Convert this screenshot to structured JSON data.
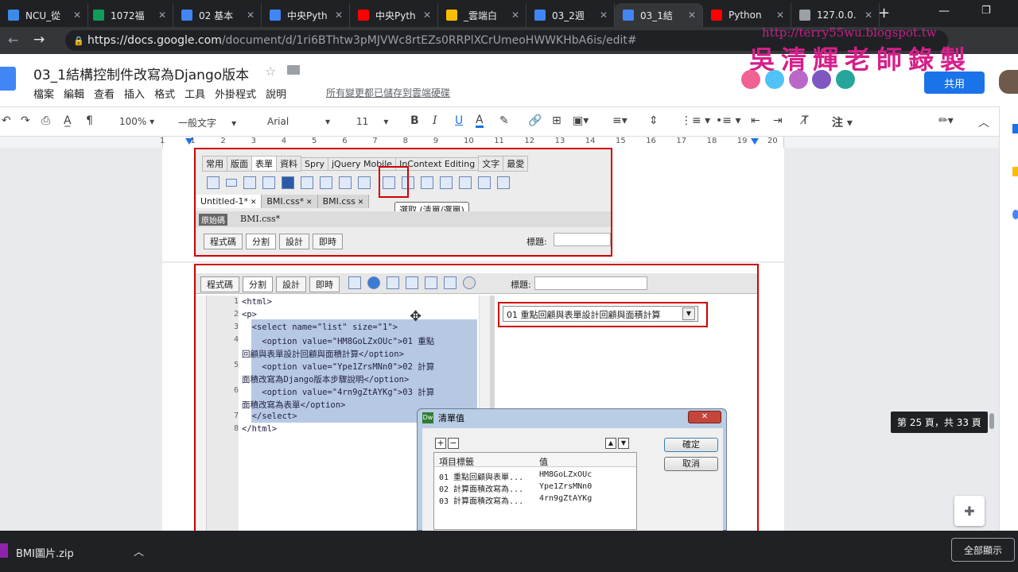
{
  "tabs": [
    {
      "label": "NCU_從",
      "fav": "#3b8be8"
    },
    {
      "label": "1072福",
      "fav": "#0f9d58"
    },
    {
      "label": "02 基本",
      "fav": "#4285f4"
    },
    {
      "label": "中央Pyth",
      "fav": "#4285f4"
    },
    {
      "label": "中央Pyth",
      "fav": "#ff0000"
    },
    {
      "label": "_雲端白",
      "fav": "#fbbc04"
    },
    {
      "label": "03_2週",
      "fav": "#4285f4"
    },
    {
      "label": "03_1結",
      "fav": "#4285f4"
    },
    {
      "label": "Python",
      "fav": "#ff0000"
    },
    {
      "label": "127.0.0.",
      "fav": "#9aa0a6"
    }
  ],
  "address": {
    "host": "https://docs.google.com",
    "path": "/document/d/1ri6BThtw3pMJVWc8rtEZs0RRPlXCrUmeoHWWKHbA6is/edit#"
  },
  "watermark": {
    "url": "http://terry55wu.blogspot.tw",
    "name": "吳清輝老師錄製"
  },
  "doc": {
    "title": "03_1結構控制件改寫為Django版本",
    "saved": "所有變更都已儲存到雲端硬碟",
    "share": "共用",
    "menus": [
      "檔案",
      "編輯",
      "查看",
      "插入",
      "格式",
      "工具",
      "外掛程式",
      "說明"
    ]
  },
  "toolbar": {
    "zoom": "100%",
    "style": "一般文字",
    "font": "Arial",
    "size": "11",
    "bold": "B",
    "italic": "I",
    "underline": "U",
    "note": "注"
  },
  "ruler": [
    "1",
    "1",
    "2",
    "3",
    "4",
    "5",
    "6",
    "7",
    "8",
    "9",
    "10",
    "11",
    "12",
    "13",
    "14",
    "15",
    "16",
    "17",
    "18",
    "19",
    "20"
  ],
  "dw_top": {
    "tabs": [
      "常用",
      "版面",
      "表單",
      "資料",
      "Spry",
      "jQuery Mobile",
      "InContext Editing",
      "文字",
      "最愛"
    ],
    "doc_tabs": [
      "Untitled-1*",
      "BMI.css*",
      "BMI.css"
    ],
    "tooltip": "選取 (清單/選單)",
    "source_tag": "原始碼",
    "file": "BMI.css*",
    "views": [
      "程式碼",
      "分割",
      "設計",
      "即時"
    ],
    "title_label": "標題:"
  },
  "dw_main": {
    "views": [
      "程式碼",
      "分割",
      "設計",
      "即時"
    ],
    "title_label": "標題:",
    "code_lines": [
      {
        "n": "1",
        "t": "<html>"
      },
      {
        "n": "2",
        "t": "<p>"
      },
      {
        "n": "3",
        "t": "  <select name=\"list\" size=\"1\">"
      },
      {
        "n": "4",
        "t": "    <option value=\"HM8GoLZxOUc\">01 重點"
      },
      {
        "n": "",
        "t": "回顧與表單設計回顧與面積計算</option>"
      },
      {
        "n": "5",
        "t": "    <option value=\"Ype1ZrsMNn0\">02 計算"
      },
      {
        "n": "",
        "t": "面積改寫為Django版本步驟說明</option>"
      },
      {
        "n": "6",
        "t": "    <option value=\"4rn9gZtAYKg\">03 計算"
      },
      {
        "n": "",
        "t": "面積改寫為表單</option>"
      },
      {
        "n": "7",
        "t": "  </select>"
      },
      {
        "n": "8",
        "t": "</html>"
      }
    ],
    "select_value": "01 重點回顧與表單設計回顧與面積計算"
  },
  "dialog": {
    "title": "清單值",
    "ok": "確定",
    "cancel": "取消",
    "col_label": "項目標籤",
    "col_value": "值",
    "rows": [
      {
        "label": "01 重點回顧與表單...",
        "value": "HM8GoLZxOUc"
      },
      {
        "label": "02 計算面積改寫為...",
        "value": "Ype1ZrsMNn0"
      },
      {
        "label": "03 計算面積改寫為...",
        "value": "4rn9gZtAYKg"
      }
    ]
  },
  "page_indicator": "第 25 頁，共 33 頁",
  "download": {
    "file": "BMI圖片.zip",
    "show_all": "全部顯示"
  },
  "colors": {
    "accent": "#1a73e8",
    "red_box": "#d00000"
  }
}
